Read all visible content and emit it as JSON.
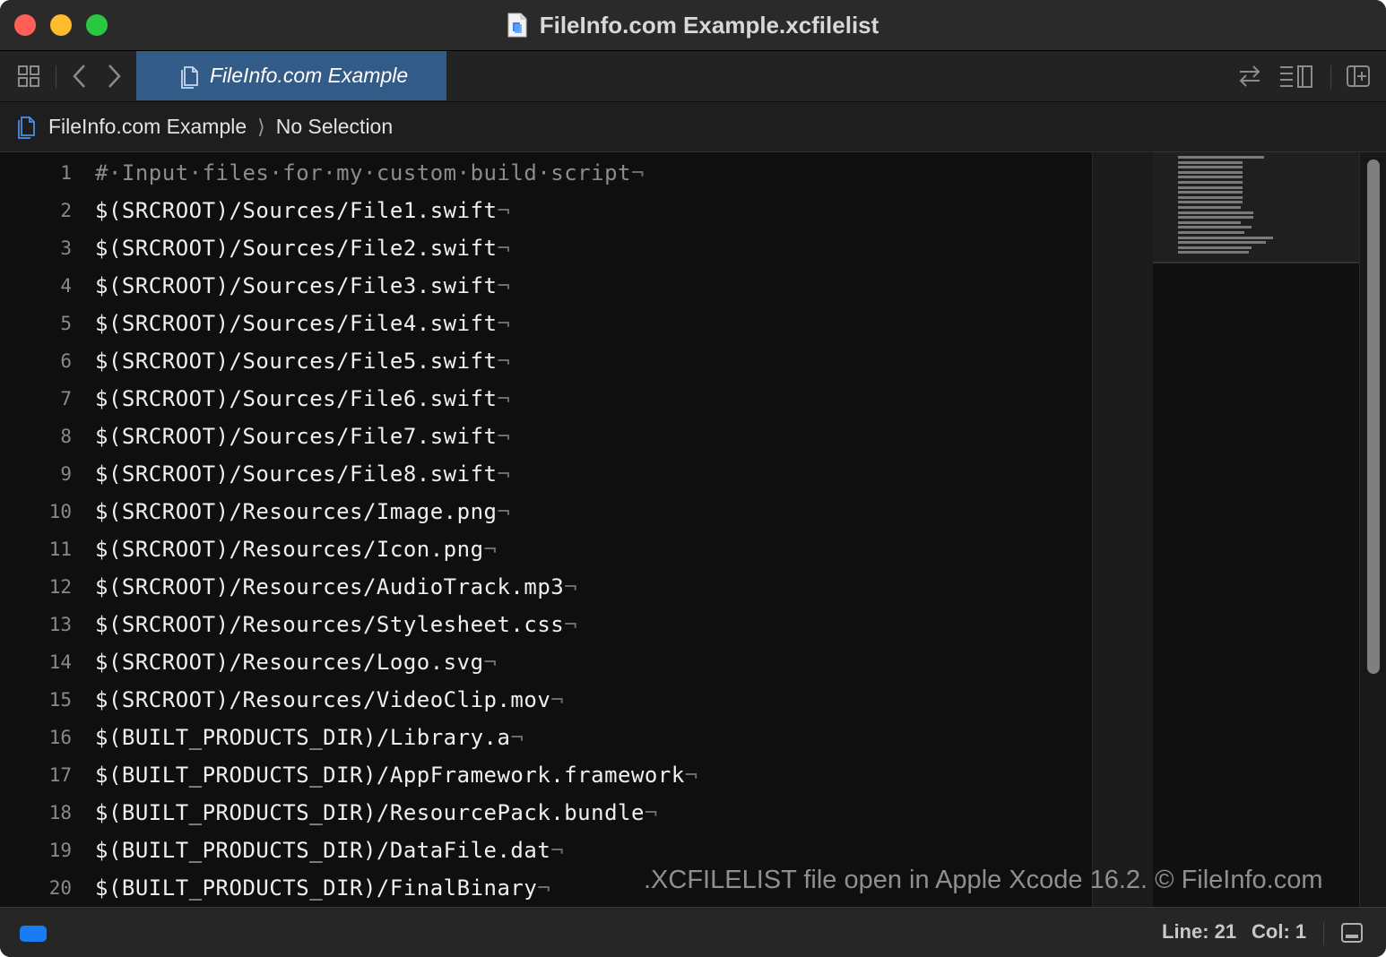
{
  "window": {
    "title": "FileInfo.com Example.xcfilelist"
  },
  "tab": {
    "label": "FileInfo.com Example"
  },
  "breadcrumb": {
    "file": "FileInfo.com Example",
    "separator": "⟩",
    "selection": "No Selection"
  },
  "editor": {
    "newline_glyph": "¬",
    "lines": [
      {
        "number": "1",
        "text": "#·Input·files·for·my·custom·build·script",
        "comment": true
      },
      {
        "number": "2",
        "text": "$(SRCROOT)/Sources/File1.swift"
      },
      {
        "number": "3",
        "text": "$(SRCROOT)/Sources/File2.swift"
      },
      {
        "number": "4",
        "text": "$(SRCROOT)/Sources/File3.swift"
      },
      {
        "number": "5",
        "text": "$(SRCROOT)/Sources/File4.swift"
      },
      {
        "number": "6",
        "text": "$(SRCROOT)/Sources/File5.swift"
      },
      {
        "number": "7",
        "text": "$(SRCROOT)/Sources/File6.swift"
      },
      {
        "number": "8",
        "text": "$(SRCROOT)/Sources/File7.swift"
      },
      {
        "number": "9",
        "text": "$(SRCROOT)/Sources/File8.swift"
      },
      {
        "number": "10",
        "text": "$(SRCROOT)/Resources/Image.png"
      },
      {
        "number": "11",
        "text": "$(SRCROOT)/Resources/Icon.png"
      },
      {
        "number": "12",
        "text": "$(SRCROOT)/Resources/AudioTrack.mp3"
      },
      {
        "number": "13",
        "text": "$(SRCROOT)/Resources/Stylesheet.css"
      },
      {
        "number": "14",
        "text": "$(SRCROOT)/Resources/Logo.svg"
      },
      {
        "number": "15",
        "text": "$(SRCROOT)/Resources/VideoClip.mov"
      },
      {
        "number": "16",
        "text": "$(BUILT_PRODUCTS_DIR)/Library.a"
      },
      {
        "number": "17",
        "text": "$(BUILT_PRODUCTS_DIR)/AppFramework.framework"
      },
      {
        "number": "18",
        "text": "$(BUILT_PRODUCTS_DIR)/ResourcePack.bundle"
      },
      {
        "number": "19",
        "text": "$(BUILT_PRODUCTS_DIR)/DataFile.dat"
      },
      {
        "number": "20",
        "text": "$(BUILT_PRODUCTS_DIR)/FinalBinary"
      }
    ]
  },
  "watermark": ".XCFILELIST file open in Apple Xcode 16.2. © FileInfo.com",
  "status": {
    "line": "Line: 21",
    "col": "Col: 1"
  },
  "icons": {
    "grid": "grid-icon",
    "back": "chevron-left-icon",
    "forward": "chevron-right-icon",
    "file": "document-icon",
    "swap": "swap-arrows-icon",
    "inspector": "inspector-icon",
    "add_editor": "add-editor-icon",
    "debug_area": "debug-area-icon"
  },
  "colors": {
    "active_tab": "#335b87",
    "status_indicator": "#1a7cf5",
    "close": "#ff5f57",
    "minimize": "#febc2e",
    "zoom": "#28c840"
  }
}
